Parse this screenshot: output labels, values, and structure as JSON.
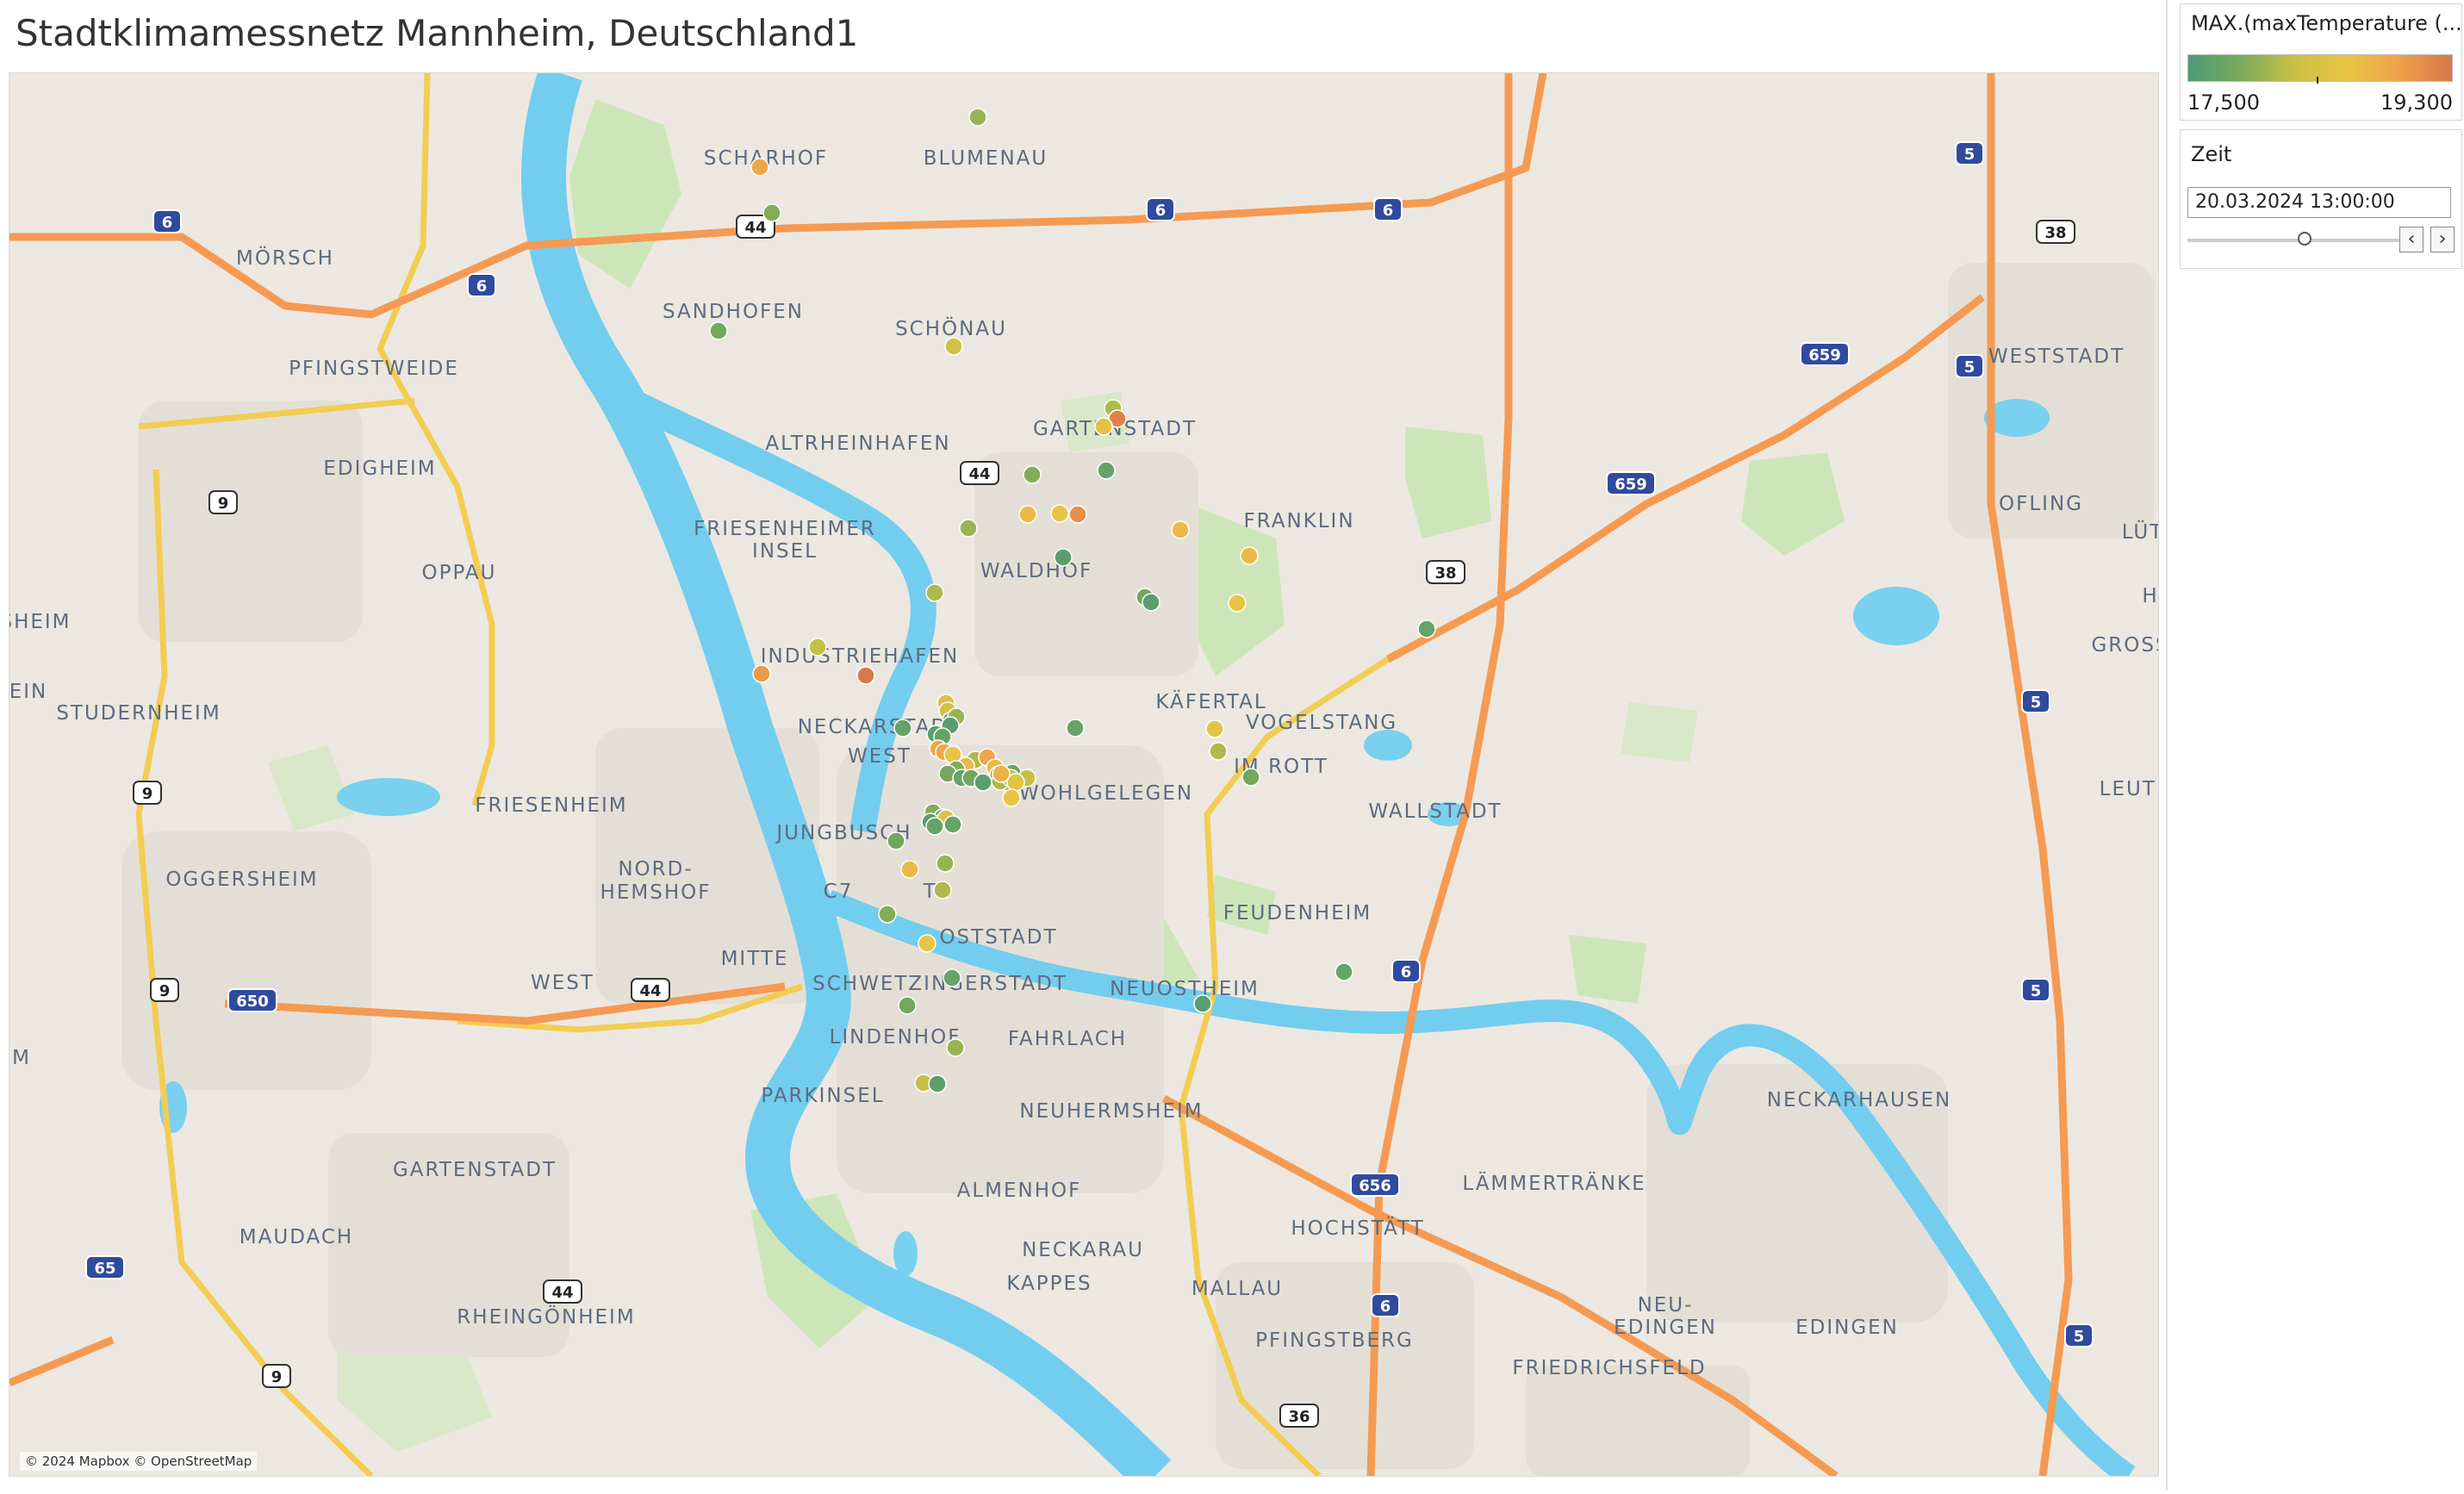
{
  "title": "Stadtklimamessnetz Mannheim, Deutschland1",
  "attribution": "© 2024 Mapbox © OpenStreetMap",
  "legend": {
    "title": "MAX.(maxTemperature (...",
    "min_label": "17,500",
    "max_label": "19,300",
    "colors": [
      "#4e9a78",
      "#7aaa5a",
      "#c9c045",
      "#e9c545",
      "#efa24a",
      "#d8774a"
    ]
  },
  "time_filter": {
    "title": "Zeit",
    "value": "20.03.2024 13:00:00",
    "prev_icon": "chevron-left-icon",
    "next_icon": "chevron-right-icon"
  },
  "place_labels": [
    "SCHARHOF",
    "BLUMENAU",
    "MÖRSCH",
    "SANDHOFEN",
    "SCHÖNAU",
    "PFINGSTWEIDE",
    "EDIGHEIM",
    "ALTRHEINHAFEN",
    "GARTENSTADT",
    "FRIESENHEIMER",
    "INSEL",
    "WALDHOF",
    "FRANKLIN",
    "OPPAU",
    "SHEIM",
    "EIN",
    "INDUSTRIEHAFEN",
    "KÄFERTAL",
    "VOGELSTANG",
    "STUDERNHEIM",
    "NECKARSTADT",
    "WEST",
    "IM ROTT",
    "WOHLGELEGEN",
    "WALLSTADT",
    "FRIESENHEIM",
    "JUNGBUSCH",
    "NORD-",
    "HEMSHOF",
    "OGGERSHEIM",
    "C7",
    "T6",
    "FEUDENHEIM",
    "OSTSTADT",
    "MITTE",
    "WEST",
    "SCHWETZINGERSTADT",
    "NEUOSTHEIM",
    "M",
    "LINDENHOF",
    "FAHRLACH",
    "PARKINSEL",
    "NEUHERMSHEIM",
    "NECKARHAUSEN",
    "GARTENSTADT",
    "LÄMMERTRÄNKE",
    "ALMENHOF",
    "HOCHSTÄTT",
    "MAUDACH",
    "NECKARAU",
    "KAPPES",
    "MALLAU",
    "RHEINGÖNHEIM",
    "PFINGSTBERG",
    "NEU-",
    "EDINGEN",
    "EDINGEN",
    "FRIEDRICHSFELD",
    "WESTSTADT",
    "OFLING",
    "LÜT",
    "GROSS",
    "H",
    "LEUTER"
  ],
  "road_shields": [
    "6",
    "6",
    "6",
    "6",
    "44",
    "44",
    "38",
    "38",
    "659",
    "659",
    "5",
    "5",
    "5",
    "5",
    "5",
    "9",
    "9",
    "9",
    "9",
    "650",
    "44",
    "6",
    "656",
    "6",
    "65",
    "44",
    "36"
  ],
  "chart_data": {
    "type": "map",
    "metric": "MAX.(maxTemperature (...",
    "color_range": [
      17.5,
      19.3
    ],
    "stations": [
      {
        "value": 18.0
      },
      {
        "value": 18.9
      },
      {
        "value": 17.9
      },
      {
        "value": 17.8
      },
      {
        "value": 18.3
      },
      {
        "value": 18.1
      },
      {
        "value": 19.2
      },
      {
        "value": 18.5
      },
      {
        "value": 17.7
      },
      {
        "value": 17.9
      },
      {
        "value": 18.7
      },
      {
        "value": 18.6
      },
      {
        "value": 19.1
      },
      {
        "value": 18.0
      },
      {
        "value": 18.7
      },
      {
        "value": 17.6
      },
      {
        "value": 18.7
      },
      {
        "value": 18.1
      },
      {
        "value": 17.8
      },
      {
        "value": 17.6
      },
      {
        "value": 18.6
      },
      {
        "value": 17.7
      },
      {
        "value": 18.2
      },
      {
        "value": 19.0
      },
      {
        "value": 19.3
      },
      {
        "value": 18.4
      },
      {
        "value": 18.3
      },
      {
        "value": 17.8
      },
      {
        "value": 18.0
      },
      {
        "value": 17.6
      },
      {
        "value": 17.7
      },
      {
        "value": 17.6
      },
      {
        "value": 17.7
      },
      {
        "value": 18.9
      },
      {
        "value": 18.9
      },
      {
        "value": 18.8
      },
      {
        "value": 18.1
      },
      {
        "value": 17.7
      },
      {
        "value": 18.5
      },
      {
        "value": 18.1
      },
      {
        "value": 17.8
      },
      {
        "value": 17.7
      },
      {
        "value": 18.7
      },
      {
        "value": 18.6
      },
      {
        "value": 17.9
      },
      {
        "value": 17.8
      },
      {
        "value": 17.7
      },
      {
        "value": 18.2
      },
      {
        "value": 18.0
      },
      {
        "value": 17.8
      },
      {
        "value": 17.6
      },
      {
        "value": 18.9
      },
      {
        "value": 18.7
      },
      {
        "value": 17.9
      },
      {
        "value": 18.1
      },
      {
        "value": 18.2
      },
      {
        "value": 18.5
      },
      {
        "value": 18.8
      },
      {
        "value": 18.6
      },
      {
        "value": 17.9
      },
      {
        "value": 17.7
      },
      {
        "value": 18.4
      },
      {
        "value": 17.7
      },
      {
        "value": 17.6
      },
      {
        "value": 17.7
      },
      {
        "value": 17.8
      },
      {
        "value": 18.0
      },
      {
        "value": 18.7
      },
      {
        "value": 18.1
      },
      {
        "value": 17.9
      },
      {
        "value": 18.6
      },
      {
        "value": 17.7
      },
      {
        "value": 17.8
      },
      {
        "value": 18.0
      },
      {
        "value": 17.6
      },
      {
        "value": 17.7
      },
      {
        "value": 18.2
      },
      {
        "value": 17.6
      }
    ]
  }
}
